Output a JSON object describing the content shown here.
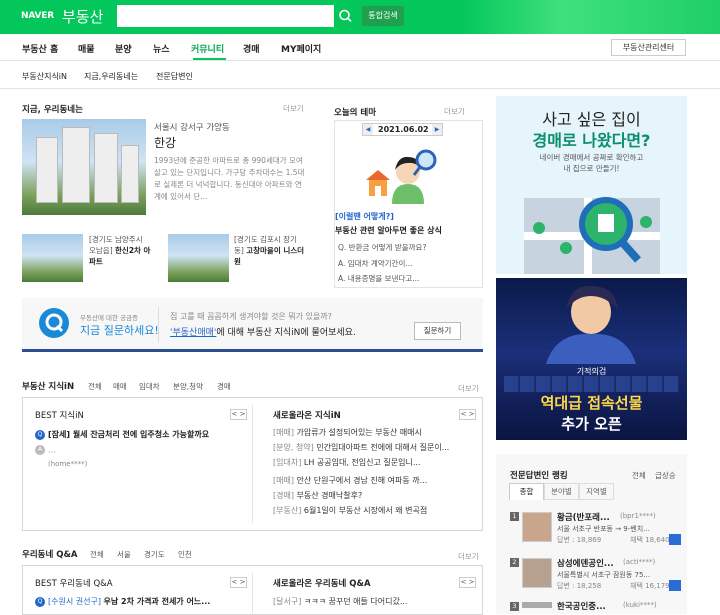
{
  "header": {
    "logo": "NAVER",
    "service": "부동산",
    "search_placeholder": "",
    "advanced_search": "통합검색"
  },
  "gnb": {
    "items": [
      "부동산 홈",
      "매물",
      "분양",
      "뉴스",
      "커뮤니티",
      "경매",
      "MY페이지"
    ],
    "active": "커뮤니티",
    "center_button": "부동산관리센터"
  },
  "lnb": {
    "items": [
      "부동산지식iN",
      "지금,우리동네는",
      "전문답변인"
    ]
  },
  "neighborhood": {
    "title": "지금, 우리동네는",
    "more": "더보기",
    "location": "서울시 강서구 가양동",
    "name": "한강",
    "desc": "1993년에 준공한 아파트로 총 990세대가 모여살고 있는 단지입니다. 가구당 주차대수는 1.5대로 실제론 더 넉넉합니다. 동신대아 아파트와 연계에 있어서 단...",
    "sub": [
      {
        "tag": "[경기도 남양주시 오남읍]",
        "name": "한신2차 아파트"
      },
      {
        "tag": "[경기도 김포시 장기동]",
        "name": "고창마을이 니스더원"
      }
    ]
  },
  "theme": {
    "title": "오늘의 테마",
    "more": "더보기",
    "date": "2021.06.02",
    "prev": "◀",
    "next": "▶",
    "headline": "[이럴땐 어떻게?]",
    "subhead": "부동산 관련 알아두면 좋은 상식",
    "items": [
      "Q. 반환금 어떻게 받을까요?",
      "A. 임대차 계약기간이...",
      "A. 내용증명을 보낸다고..."
    ]
  },
  "qbanner": {
    "small": "부동산에 대한 궁금증",
    "big": "지금 질문하세요!",
    "line1": "집 고를 때 꼼꼼하게 생겨야할 것은 뭐가 있을까?",
    "keyword": "'부동산매매'",
    "line2": "에 대해 부동산 지식iN에 물어보세요.",
    "button": "질문하기"
  },
  "kin": {
    "title": "부동산 지식iN",
    "tabs": [
      "전체",
      "매매",
      "임대차",
      "분양,청약",
      "경매"
    ],
    "more": "더보기",
    "best_title": "BEST 지식iN",
    "best_items": [
      "[잠세] 월세 잔금처리 전에 입주청소 가능할까요",
      "...",
      "(home****)"
    ],
    "new_title": "새로올라온 지식iN",
    "new_items": [
      {
        "tag": "[매매]",
        "text": "가압류가 설정되어있는 부동산 매매시"
      },
      {
        "tag": "[분양, 청약]",
        "text": "민간임대아파트 전에에 대해서 질문이..."
      },
      {
        "tag": "[임대차]",
        "text": "LH 공공임대, 전입신고 질문입니..."
      },
      {
        "tag": "[매매]",
        "text": "안산 단원구에서 경남 진해 여파동 까..."
      },
      {
        "tag": "[경매]",
        "text": "부동산 경매낙찰후?"
      },
      {
        "tag": "[부동산]",
        "text": "6월1일이 부동산 시장에서 왜 변곡점"
      }
    ],
    "prev": "<",
    "next": ">"
  },
  "local_qa": {
    "title": "우리동네 Q&A",
    "tabs": [
      "전체",
      "서울",
      "경기도",
      "인천"
    ],
    "more": "더보기",
    "best_title": "BEST 우리동네 Q&A",
    "best_first_tag": "[수원시 권선구]",
    "best_first": "우남 2차 가격과 전세가 어느...",
    "new_title": "새로올라온 우리동네 Q&A",
    "new_first_tag": "[달서구]",
    "new_first": "ㅋㅋㅋ 꿈꾸던 애들 다어디갔...",
    "prev": "<",
    "next": ">"
  },
  "ad1": {
    "line1": "사고 싶은 집이",
    "line2": "경매로 나왔다면?",
    "line3": "네이버 경매에서 공짜로 확인하고",
    "line4": "내 집으로 만들기!"
  },
  "ad2": {
    "top": "기적의검",
    "line1": "역대급 접속선물",
    "line2": "추가 오픈"
  },
  "ranking": {
    "title": "전문답변인 랭킹",
    "filter1": "전체",
    "filter2": "급상승",
    "tabs": [
      "종합",
      "분야별",
      "지역별"
    ],
    "items": [
      {
        "rank": "1",
        "name": "황금(반포래...",
        "id": "(bpr1****)",
        "office": "서울 서초구 반포동 → 9-벤치...",
        "answers": "답변 : 18,869",
        "likes_label": "채택",
        "likes": "18,640"
      },
      {
        "rank": "2",
        "name": "삼성에덴공인...",
        "id": "(acti****)",
        "office": "서울특별시 서초구 잠원동 75...",
        "answers": "답변 : 18,258",
        "likes_label": "채택",
        "likes": "16,179"
      },
      {
        "rank": "3",
        "name": "한국공인중...",
        "id": "(kuki****)",
        "office": "",
        "answers": "",
        "likes_label": "",
        "likes": ""
      }
    ]
  },
  "colors": {
    "brand": "#03c75a",
    "link": "#2266cc"
  }
}
